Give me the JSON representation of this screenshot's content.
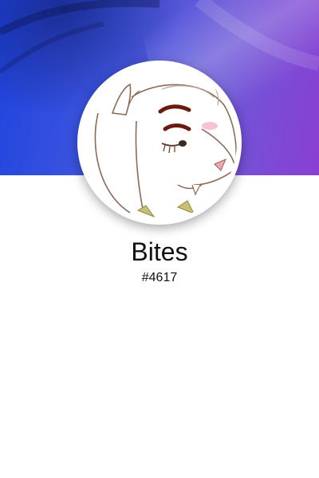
{
  "profile": {
    "display_name": "Bites",
    "discriminator": "#4617"
  },
  "banner": {
    "colors": [
      "#1f44de",
      "#3f55df",
      "#6a5ad8",
      "#8a3fd2"
    ]
  },
  "avatar": {
    "description_icon": "goat-character-avatar"
  }
}
